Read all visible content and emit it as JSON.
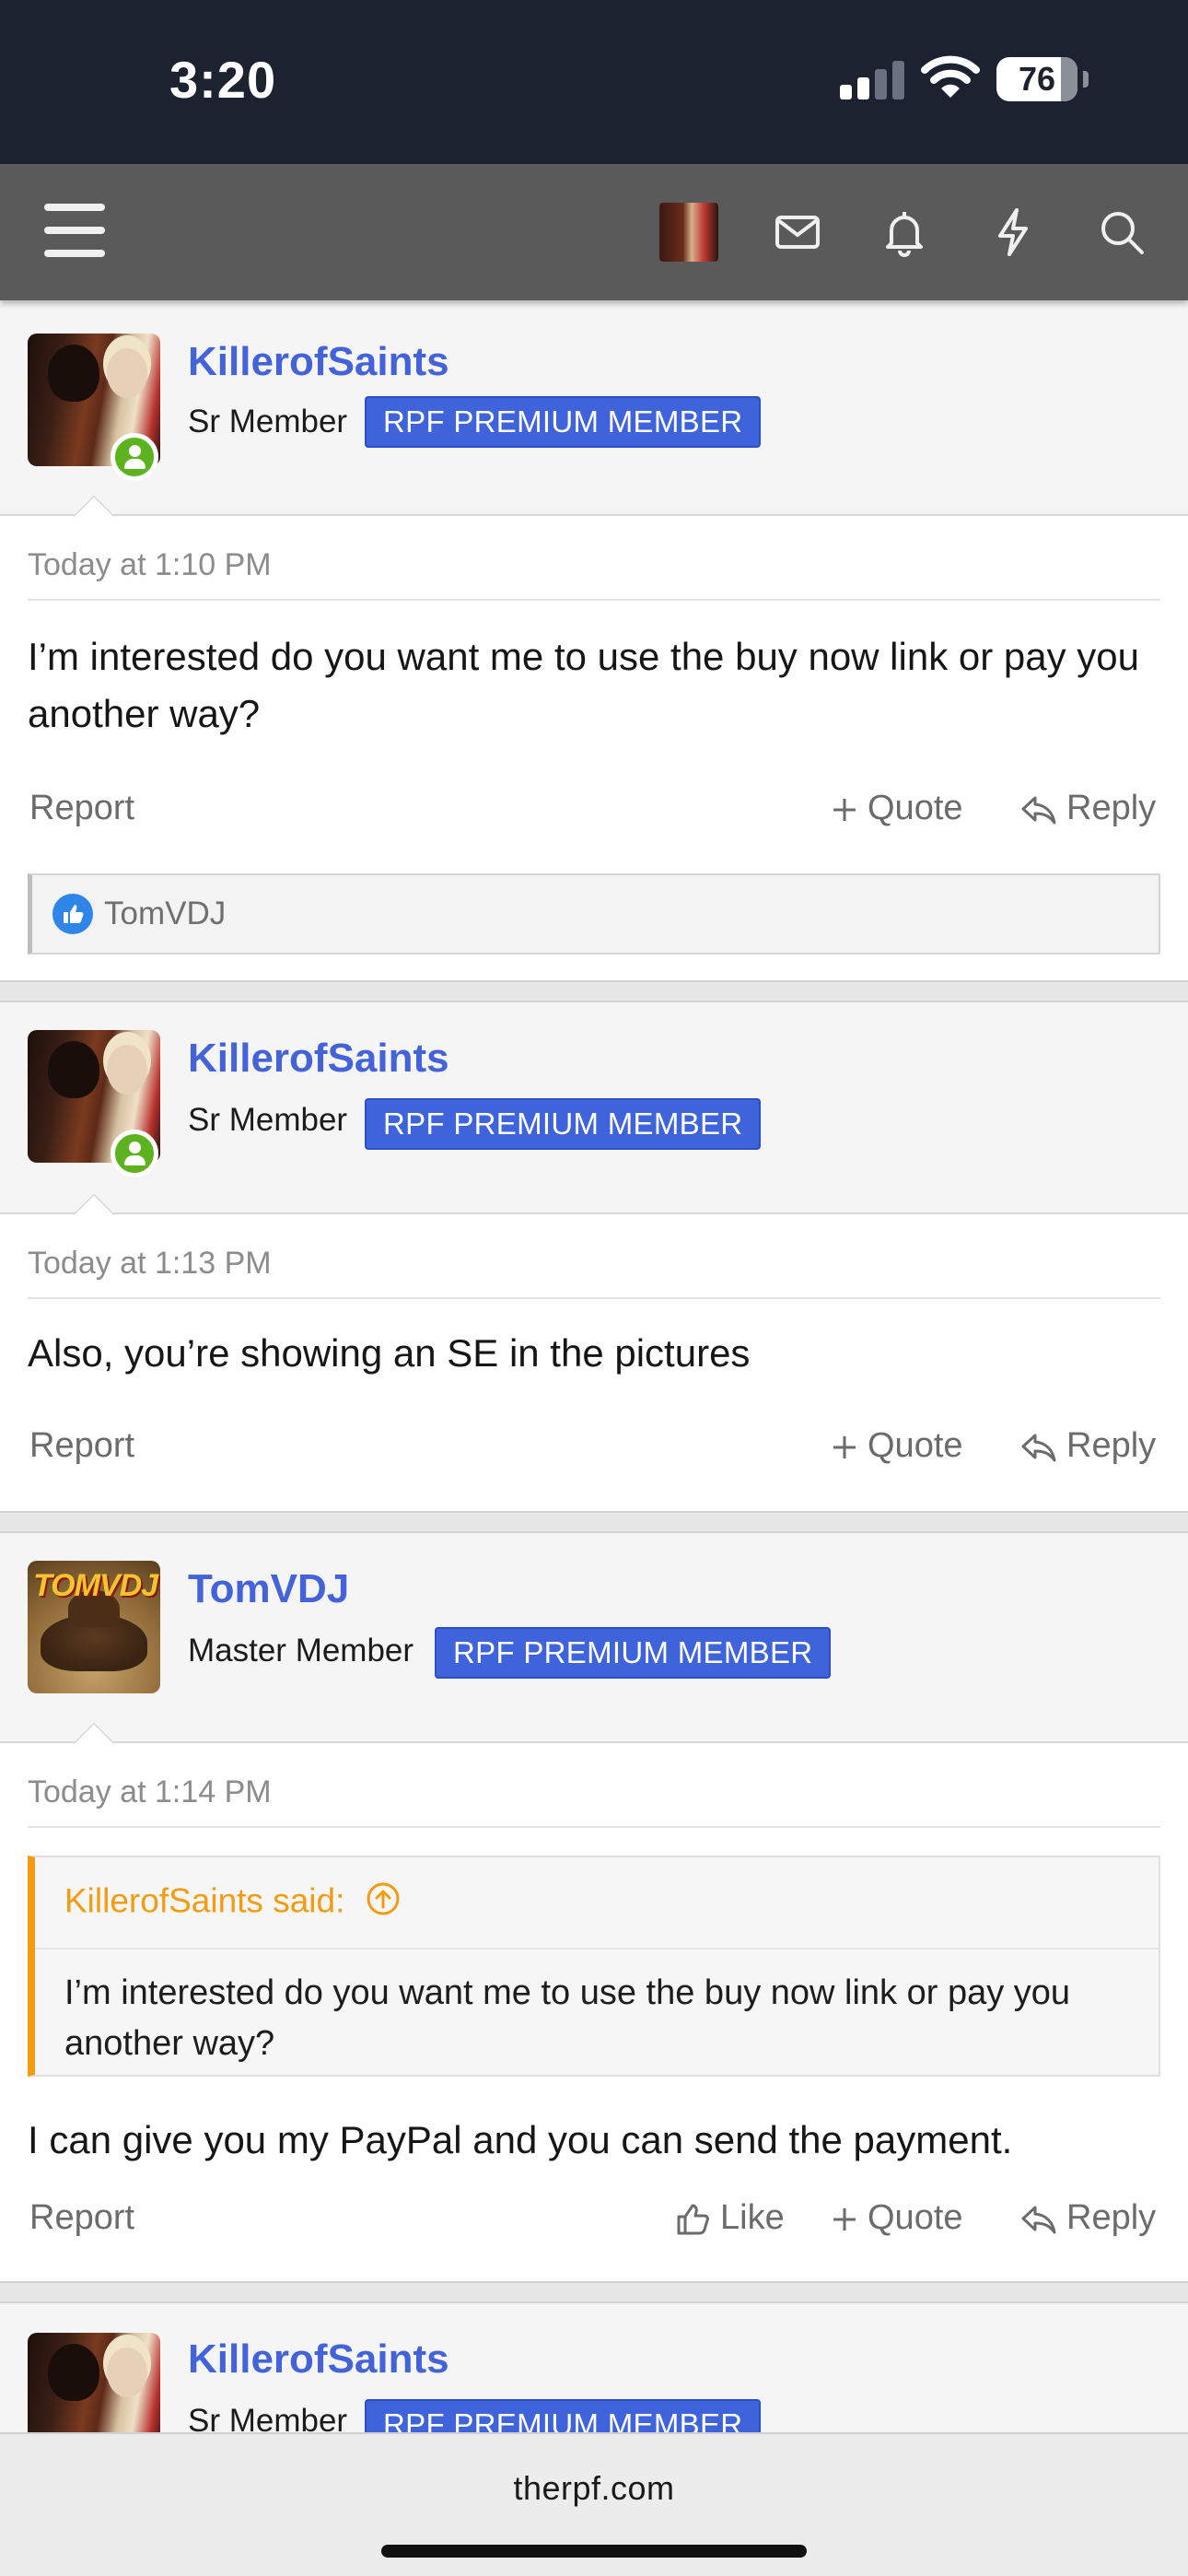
{
  "status_bar": {
    "time": "3:20",
    "battery": "76"
  },
  "nav": {
    "icons": [
      "menu-icon",
      "user-avatar",
      "envelope-icon",
      "bell-icon",
      "bolt-icon",
      "search-icon"
    ]
  },
  "posts": [
    {
      "username": "KillerofSaints",
      "title": "Sr Member",
      "badge": "RPF PREMIUM MEMBER",
      "date": "Today at 1:10 PM",
      "text": "I’m interested do you want me to use the buy now link or pay you another way?",
      "actions": {
        "report": "Report",
        "quote": "Quote",
        "reply": "Reply"
      },
      "liked_by": "TomVDJ"
    },
    {
      "username": "KillerofSaints",
      "title": "Sr Member",
      "badge": "RPF PREMIUM MEMBER",
      "date": "Today at 1:13 PM",
      "text": "Also, you’re showing an SE in the pictures",
      "actions": {
        "report": "Report",
        "quote": "Quote",
        "reply": "Reply"
      }
    },
    {
      "username": "TomVDJ",
      "title": "Master Member",
      "badge": "RPF PREMIUM MEMBER",
      "avatar_text": "TOMVDJ",
      "date": "Today at 1:14 PM",
      "quote": {
        "author": "KillerofSaints said:",
        "text": "I’m interested do you want me to use the buy now link or pay you another way?"
      },
      "text": "I can give you my PayPal and you can send the payment.",
      "actions": {
        "report": "Report",
        "like": "Like",
        "quote": "Quote",
        "reply": "Reply"
      }
    },
    {
      "username": "KillerofSaints",
      "title": "Sr Member",
      "badge": "RPF PREMIUM MEMBER"
    }
  ],
  "browser": {
    "domain": "therpf.com"
  },
  "colors": {
    "link": "#4563d8",
    "badge": "#3e63db",
    "quote_accent": "#f39c12",
    "online": "#5cb21f",
    "navbar": "#5a5a5a",
    "statusbar": "#1c2230"
  }
}
